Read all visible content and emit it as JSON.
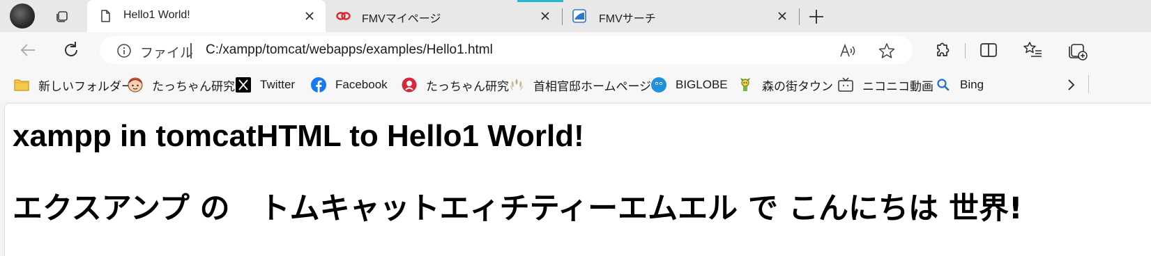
{
  "tabs": [
    {
      "title": "Hello1 World!",
      "active": true,
      "icon": "page-icon"
    },
    {
      "title": "FMVマイページ",
      "active": false,
      "icon": "fmv-red-logo-icon"
    },
    {
      "title": "FMVサーチ",
      "active": false,
      "icon": "fmv-search-icon"
    }
  ],
  "colors": {
    "tab_strip": "#e8e8e8",
    "toolbar": "#f7f7f7",
    "loading_accent": "#22b8cf",
    "facebook": "#1877f2",
    "biglobe": "#1e90e0",
    "twitter": "#000000"
  },
  "address": {
    "site_label": "ファイル",
    "url": "C:/xampp/tomcat/webapps/examples/Hello1.html"
  },
  "favorites": [
    {
      "label": "新しいフォルダー",
      "icon": "folder-icon"
    },
    {
      "label": "たっちゃん研究",
      "icon": "tacchan-face-icon"
    },
    {
      "label": "Twitter",
      "icon": "x-logo-icon"
    },
    {
      "label": "Facebook",
      "icon": "facebook-icon"
    },
    {
      "label": "たっちゃん研究",
      "icon": "tacchan-red-icon"
    },
    {
      "label": "首相官邸ホームページ",
      "icon": "kantei-icon"
    },
    {
      "label": "BIGLOBE",
      "icon": "biglobe-icon"
    },
    {
      "label": "森の街タウン",
      "icon": "mori-town-icon"
    },
    {
      "label": "ニコニコ動画",
      "icon": "niconico-icon"
    },
    {
      "label": "Bing",
      "icon": "bing-search-icon"
    }
  ],
  "page": {
    "heading1": "xampp in tomcatHTML to Hello1 World!",
    "heading2": "エクスアンプ の　トムキャットエィチティーエムエル で こんにちは 世界!"
  }
}
